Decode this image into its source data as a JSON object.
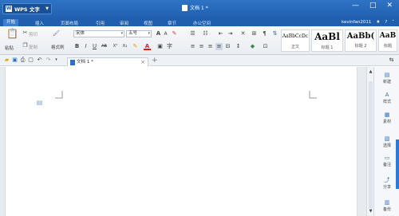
{
  "app": {
    "name": "WPS 文字",
    "logo": "W",
    "doc_title": "文档 1 *",
    "user": "kevinfan2011",
    "win_controls": [
      "—",
      "□",
      "✕"
    ]
  },
  "menus": [
    "开始",
    "插入",
    "页面布局",
    "引用",
    "审阅",
    "视图",
    "章节",
    "办公空间"
  ],
  "ribbon": {
    "paste": "粘贴",
    "cut": "剪切",
    "copy": "复制",
    "format_painter": "格式刷",
    "font_name": "宋体",
    "font_size": "五号",
    "style_normal": "正文",
    "style_h1": "标题 1",
    "style_h2": "标题 2",
    "style_h3": "标题",
    "sample_normal": "AaBbCcDc",
    "sample_h1": "AaBl",
    "sample_h2": "AaBb(",
    "sample_h3": "AaB"
  },
  "tab": {
    "label": "文档 1 *",
    "close": "×",
    "new": "+"
  },
  "side_panel": [
    {
      "label": "新建",
      "icon": "new-doc-icon"
    },
    {
      "label": "样式",
      "icon": "style-icon"
    },
    {
      "label": "素材",
      "icon": "material-icon"
    },
    {
      "label": "选择",
      "icon": "select-icon"
    },
    {
      "label": "备注",
      "icon": "note-icon"
    },
    {
      "label": "分享",
      "icon": "share-icon"
    },
    {
      "label": "备份",
      "icon": "backup-icon"
    }
  ],
  "colors": {
    "title_blue": "#1f5fae",
    "accent": "#2d79d3"
  }
}
